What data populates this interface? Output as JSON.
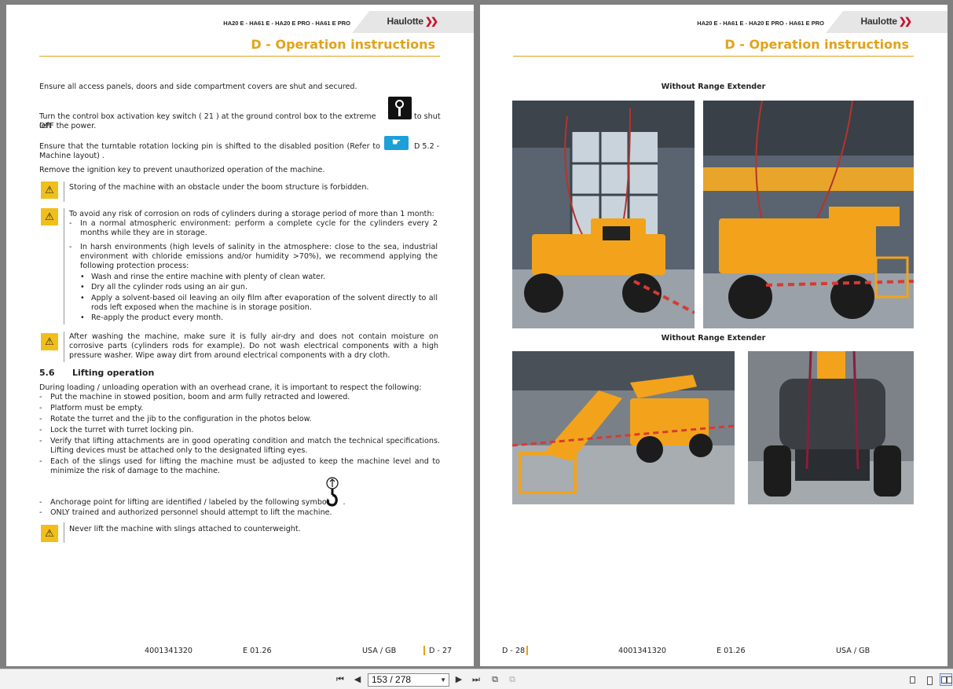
{
  "header": {
    "models": "HA20 E - HA61 E - HA20 E PRO - HA61 E PRO",
    "brand": "Haulotte",
    "section_title": "D - Operation instructions"
  },
  "left": {
    "p1": "Ensure all access panels, doors and side compartment covers are shut and secured.",
    "p2a": "Turn the control box activation key switch ( 21 ) at the ground control box to the extreme left",
    "p2b": "to shut",
    "p2c": "OFF the power.",
    "p3a": "Ensure that the turntable rotation locking pin is shifted to the disabled position (Refer to",
    "p3b": "D 5.2 -",
    "p3c": "Machine layout) .",
    "p4": "Remove the ignition key to prevent unauthorized operation of the machine.",
    "w1": "Storing of the machine with an obstacle under the boom structure is forbidden.",
    "w2_intro": "To avoid any risk of corrosion on rods of cylinders during a storage period of more than 1 month:",
    "w2_b1": "In a normal atmospheric environment: perform a complete cycle for the cylinders every 2 months while they are in storage.",
    "w2_b2": "In harsh environments (high levels of salinity in the atmosphere: close to the sea, industrial environment with chloride emissions and/or humidity >70%), we recommend applying the following protection process:",
    "w2_s1": "Wash and rinse the entire machine with plenty of clean water.",
    "w2_s2": "Dry all the cylinder rods using an air gun.",
    "w2_s3": "Apply a solvent-based oil leaving an oily film after evaporation of the solvent directly to all rods left exposed when the machine is in storage position.",
    "w2_s4": "Re-apply the product every month.",
    "w3": "After washing the machine, make sure it is fully air-dry and does not contain moisture on corrosive parts (cylinders rods for example). Do not wash electrical components with a high pressure washer. Wipe away dirt from around electrical components with a dry cloth.",
    "h_num": "5.6",
    "h_text": "Lifting operation",
    "intro": "During loading / unloading operation with an overhead crane, it is important to respect the following:",
    "l1": "Put the machine in stowed position, boom and arm fully retracted and lowered.",
    "l2": "Platform must be empty.",
    "l3": "Rotate the turret and the jib to the configuration in the photos below.",
    "l4": "Lock the turret with turret locking pin.",
    "l5": "Verify that lifting attachments are in good operating condition and match the technical specifications. Lifting devices must be attached only to the designated lifting eyes.",
    "l6": "Each of the slings used for lifting the machine must be adjusted to keep the machine level and to minimize the risk of damage to the machine.",
    "l7a": "Anchorage point for lifting are identified / labeled by the following symbol",
    "l7b": ".",
    "l8": "ONLY trained and authorized personnel should attempt to lift the machine.",
    "w4": "Never lift the machine with slings attached to counterweight.",
    "footer": {
      "doc": "4001341320",
      "rev": "E 01.26",
      "region": "USA / GB",
      "page": "D - 27"
    }
  },
  "right": {
    "cap1": "Without Range Extender",
    "cap2": "Without Range Extender",
    "footer": {
      "page": "D - 28",
      "doc": "4001341320",
      "rev": "E 01.26",
      "region": "USA / GB"
    }
  },
  "bullets": {
    "dash": "-",
    "dot": "•"
  },
  "toolbar": {
    "page_field": "153 / 278"
  },
  "colors": {
    "accent": "#e3a21a",
    "warning": "#f0bf1c",
    "ref_icon": "#1e9fd8",
    "machine": "#f2a31b"
  }
}
